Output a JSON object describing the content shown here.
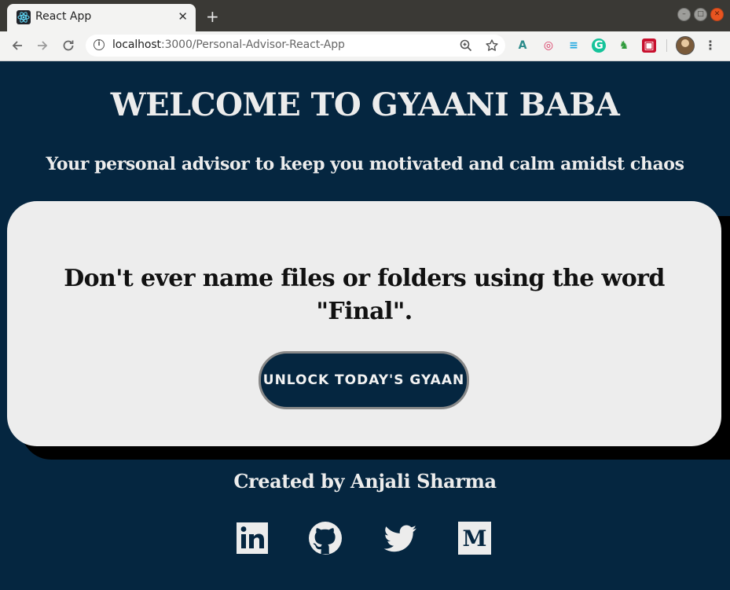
{
  "browser": {
    "tab_title": "React App",
    "tab_close": "✕",
    "new_tab": "+",
    "url_host": "localhost",
    "url_path": ":3000/Personal-Advisor-React-App",
    "icons": {
      "back": "back-arrow-icon",
      "forward": "forward-arrow-icon",
      "reload": "reload-icon",
      "info": "site-info-icon",
      "zoom": "zoom-icon",
      "bookmark": "star-icon",
      "menu": "kebab-menu-icon"
    },
    "extensions": [
      "A",
      "◎",
      "≡",
      "G",
      "♞",
      "▣"
    ],
    "extension_colors": [
      "#2a8a8a",
      "#d8345f",
      "#1aa6e0",
      "#15c39a",
      "#2e9a3a",
      "#c8102e"
    ]
  },
  "page": {
    "heading": "WELCOME TO GYAANI BABA",
    "subheading": "Your personal advisor to keep you motivated and calm amidst chaos",
    "quote": "Don't ever name files or folders using the word \"Final\".",
    "unlock_button": "UNLOCK TODAY'S GYAAN",
    "credit": "Created by Anjali Sharma",
    "social_links": [
      {
        "name": "linkedin",
        "icon": "linkedin-icon"
      },
      {
        "name": "github",
        "icon": "github-icon"
      },
      {
        "name": "twitter",
        "icon": "twitter-icon"
      },
      {
        "name": "medium",
        "icon": "medium-icon"
      }
    ]
  },
  "colors": {
    "background": "#052640",
    "card": "#ededed",
    "text_light": "#ececec",
    "text_dark": "#111111"
  }
}
